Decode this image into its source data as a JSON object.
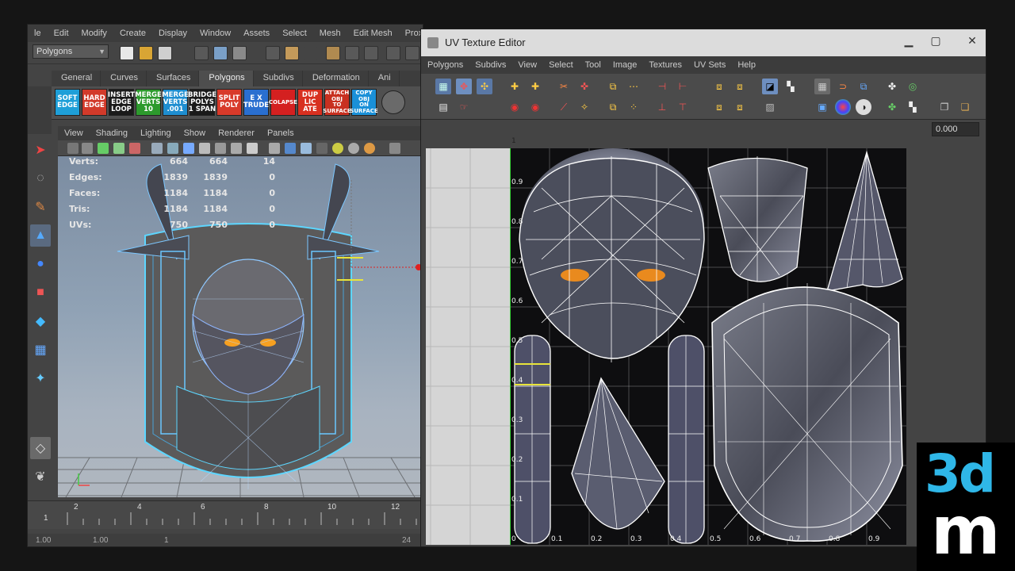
{
  "maya": {
    "menus": [
      "le",
      "Edit",
      "Modify",
      "Create",
      "Display",
      "Window",
      "Assets",
      "Select",
      "Mesh",
      "Edit Mesh",
      "Proxy"
    ],
    "mode": "Polygons",
    "shelf_tabs": [
      "General",
      "Curves",
      "Surfaces",
      "Polygons",
      "Subdivs",
      "Deformation",
      "Ani"
    ],
    "shelf_buttons": [
      {
        "label": "SOFT\nEDGE",
        "bg": "#1e9fd8"
      },
      {
        "label": "HARD\nEDGE",
        "bg": "#d23a2a"
      },
      {
        "label": "INSERT\nEDGE\nLOOP",
        "bg": "#1a1a1a"
      },
      {
        "label": "MERGE\nVERTS\n10",
        "bg": "#2d9a2d"
      },
      {
        "label": "MERGE\nVERTS\n.001",
        "bg": "#1e8ed0"
      },
      {
        "label": "BRIDGE\nPOLYS\n1 SPAN",
        "bg": "#1a1a1a"
      },
      {
        "label": "SPLIT\nPOLY",
        "bg": "#d83a2a"
      },
      {
        "label": "E X\nTRUDE",
        "bg": "#2a6fd0"
      },
      {
        "label": "COLAPSE",
        "bg": "#d42020"
      },
      {
        "label": "DUP\nLIC\nATE",
        "bg": "#d83020"
      },
      {
        "label": "ATTACH\nOBJ\nTO\nSURFACE",
        "bg": "#c83020"
      },
      {
        "label": "COPY\nOBJ\nON\nSURFACE",
        "bg": "#1a90d8"
      }
    ],
    "viewport_menus": [
      "View",
      "Shading",
      "Lighting",
      "Show",
      "Renderer",
      "Panels"
    ],
    "hud": [
      {
        "label": "Verts:",
        "v1": "664",
        "v2": "664",
        "v3": "14"
      },
      {
        "label": "Edges:",
        "v1": "1839",
        "v2": "1839",
        "v3": "0"
      },
      {
        "label": "Faces:",
        "v1": "1184",
        "v2": "1184",
        "v3": "0"
      },
      {
        "label": "Tris:",
        "v1": "1184",
        "v2": "1184",
        "v3": "0"
      },
      {
        "label": "UVs:",
        "v1": "750",
        "v2": "750",
        "v3": "0"
      }
    ],
    "timeline_ticks": [
      "2",
      "4",
      "6",
      "8",
      "10",
      "12"
    ],
    "current_frame": "1",
    "range": {
      "start": "1.00",
      "start2": "1.00",
      "frame": "1",
      "end": "24"
    }
  },
  "uv_editor": {
    "title": "UV Texture Editor",
    "menus": [
      "Polygons",
      "Subdivs",
      "View",
      "Select",
      "Tool",
      "Image",
      "Textures",
      "UV Sets",
      "Help"
    ],
    "field_value": "0.000",
    "v_labels": [
      "0.9",
      "0.8",
      "0.7",
      "0.6",
      "0.5",
      "0.4",
      "0.3",
      "0.2",
      "0.1"
    ],
    "u_labels": [
      "0.1",
      "0.2",
      "0.3",
      "0.4",
      "0.5",
      "0.6",
      "0.7",
      "0.8",
      "0.9"
    ],
    "top_label": "1",
    "origin_label": "0"
  },
  "watermark": {
    "line1": "3d",
    "line2": "m",
    "line1_color": "#2fb7e8",
    "line2_color": "#ffffff"
  },
  "icons": [
    "select-arrow-icon",
    "lasso-icon",
    "paint-icon",
    "move-icon",
    "rotate-icon",
    "scale-icon",
    "uv-grid-icon",
    "checker-icon"
  ]
}
